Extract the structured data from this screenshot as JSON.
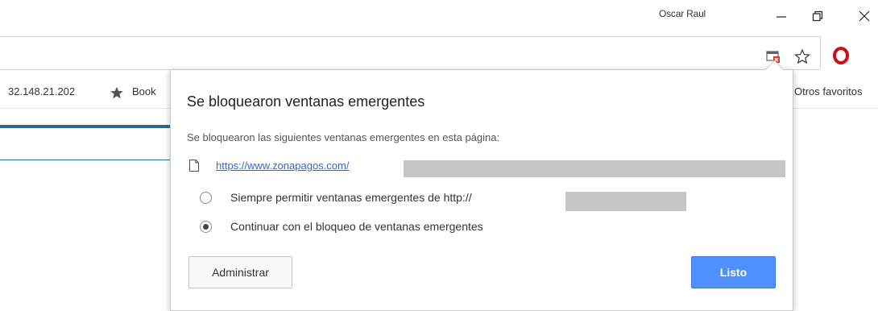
{
  "window": {
    "profile_name": "Oscar Raul",
    "minimize_icon": "minimize-icon",
    "restore_icon": "restore-icon",
    "close_icon": "close-icon"
  },
  "toolbar": {
    "popup_blocked_icon": "popup-blocked-icon",
    "bookmark_star_icon": "bookmark-star-icon",
    "opera_icon": "opera-icon"
  },
  "bookmarks_bar": {
    "ip_item": "32.148.21.202",
    "bookmarks_label": "Book",
    "other_bookmarks": "Otros favoritos"
  },
  "bubble": {
    "title": "Se bloquearon ventanas emergentes",
    "description": "Se bloquearon las siguientes ventanas emergentes en esta página:",
    "popup_link": "https://www.zonapagos.com/",
    "options": [
      {
        "label": "Siempre permitir ventanas emergentes de http://",
        "selected": false
      },
      {
        "label": "Continuar con el bloqueo de ventanas emergentes",
        "selected": true
      }
    ],
    "manage_button": "Administrar",
    "done_button": "Listo"
  },
  "colors": {
    "accent_blue": "#4d90fe",
    "link_blue": "#3367d6",
    "page_rule": "#2c6b8c",
    "opera_red": "#cc0f16"
  }
}
